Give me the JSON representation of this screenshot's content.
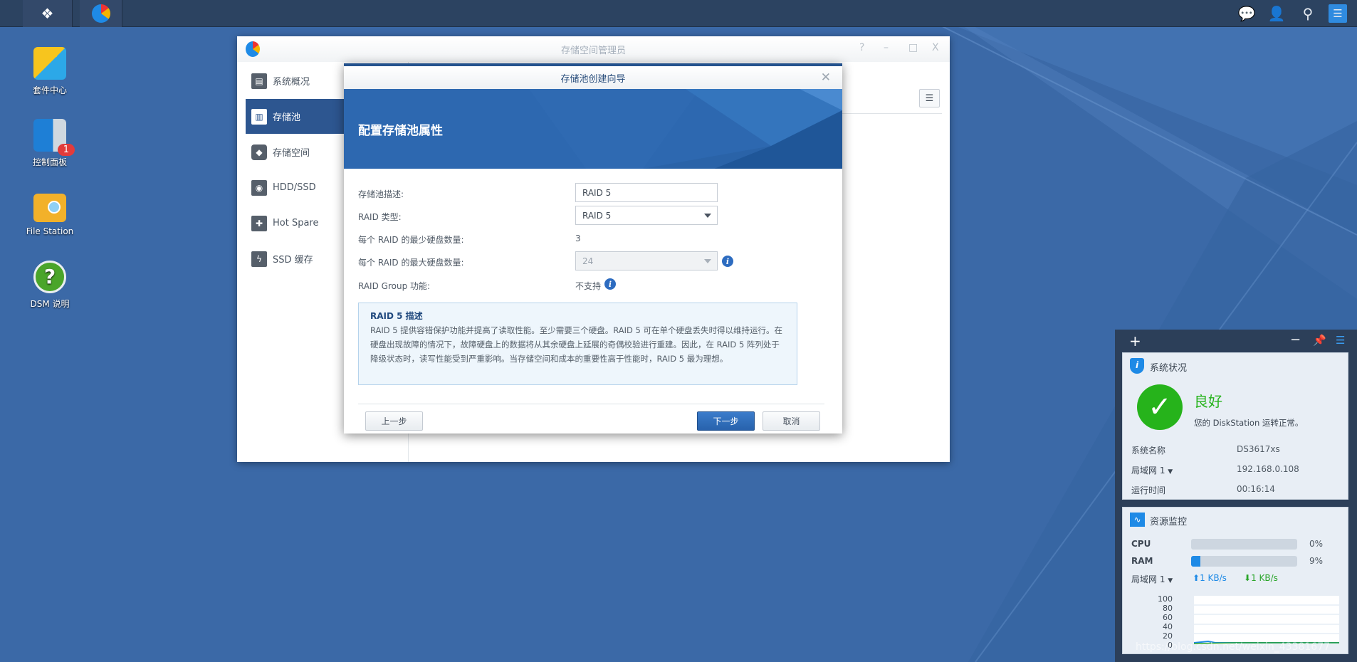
{
  "taskbar": {
    "icons": [
      "main-menu-icon",
      "storage-manager-icon"
    ],
    "right_icons": [
      "chat-icon",
      "user-icon",
      "search-icon",
      "widgets-icon"
    ]
  },
  "desktop": {
    "icons": [
      {
        "label": "套件中心",
        "icon": "package-center-icon"
      },
      {
        "label": "控制面板",
        "icon": "control-panel-icon",
        "badge": "1"
      },
      {
        "label": "File Station",
        "icon": "file-station-icon"
      },
      {
        "label": "DSM 说明",
        "icon": "help-icon"
      }
    ]
  },
  "window": {
    "title": "存储空间管理员",
    "controls": [
      "?",
      "–",
      "□",
      "X"
    ],
    "sidebar": [
      {
        "label": "系统概况",
        "icon": "overview-icon"
      },
      {
        "label": "存储池",
        "icon": "storage-pool-icon",
        "selected": true
      },
      {
        "label": "存储空间",
        "icon": "volume-icon"
      },
      {
        "label": "HDD/SSD",
        "icon": "hdd-icon"
      },
      {
        "label": "Hot Spare",
        "icon": "hot-spare-icon"
      },
      {
        "label": "SSD 缓存",
        "icon": "ssd-cache-icon"
      }
    ]
  },
  "wizard": {
    "title": "存储池创建向导",
    "heading": "配置存储池属性",
    "fields": {
      "desc_label": "存储池描述:",
      "desc_value": "RAID 5",
      "raid_label": "RAID 类型:",
      "raid_value": "RAID 5",
      "min_label": "每个 RAID 的最少硬盘数量:",
      "min_value": "3",
      "max_label": "每个 RAID 的最大硬盘数量:",
      "max_value": "24",
      "group_label": "RAID Group 功能:",
      "group_value": "不支持"
    },
    "description": {
      "title": "RAID 5 描述",
      "text": "RAID 5 提供容错保护功能并提高了读取性能。至少需要三个硬盘。RAID 5 可在单个硬盘丢失时得以维持运行。在硬盘出现故障的情况下，故障硬盘上的数据将从其余硬盘上延展的奇偶校验进行重建。因此，在 RAID 5 阵列处于降级状态时，读写性能受到严重影响。当存储空间和成本的重要性高于性能时，RAID 5 最为理想。"
    },
    "buttons": {
      "back": "上一步",
      "next": "下一步",
      "cancel": "取消"
    }
  },
  "widgets": {
    "status": {
      "title": "系统状况",
      "state": "良好",
      "message": "您的 DiskStation 运转正常。",
      "rows": [
        {
          "k": "系统名称",
          "v": "DS3617xs"
        },
        {
          "k": "局域网 1",
          "v": "192.168.0.108"
        },
        {
          "k": "运行时间",
          "v": "00:16:14"
        }
      ]
    },
    "monitor": {
      "title": "资源监控",
      "cpu_label": "CPU",
      "cpu": "0%",
      "cpu_value": 0,
      "ram_label": "RAM",
      "ram": "9%",
      "ram_value": 9,
      "lan_label": "局域网 1",
      "upload": "1 KB/s",
      "download": "1 KB/s",
      "y_ticks": [
        "100",
        "80",
        "60",
        "40",
        "20",
        "0"
      ]
    },
    "colors": {
      "good": "#26b31b",
      "upload": "#1e8ae6",
      "download": "#2aa52a"
    }
  },
  "watermark": "https://blog.csdn.net/weixin_43381677"
}
